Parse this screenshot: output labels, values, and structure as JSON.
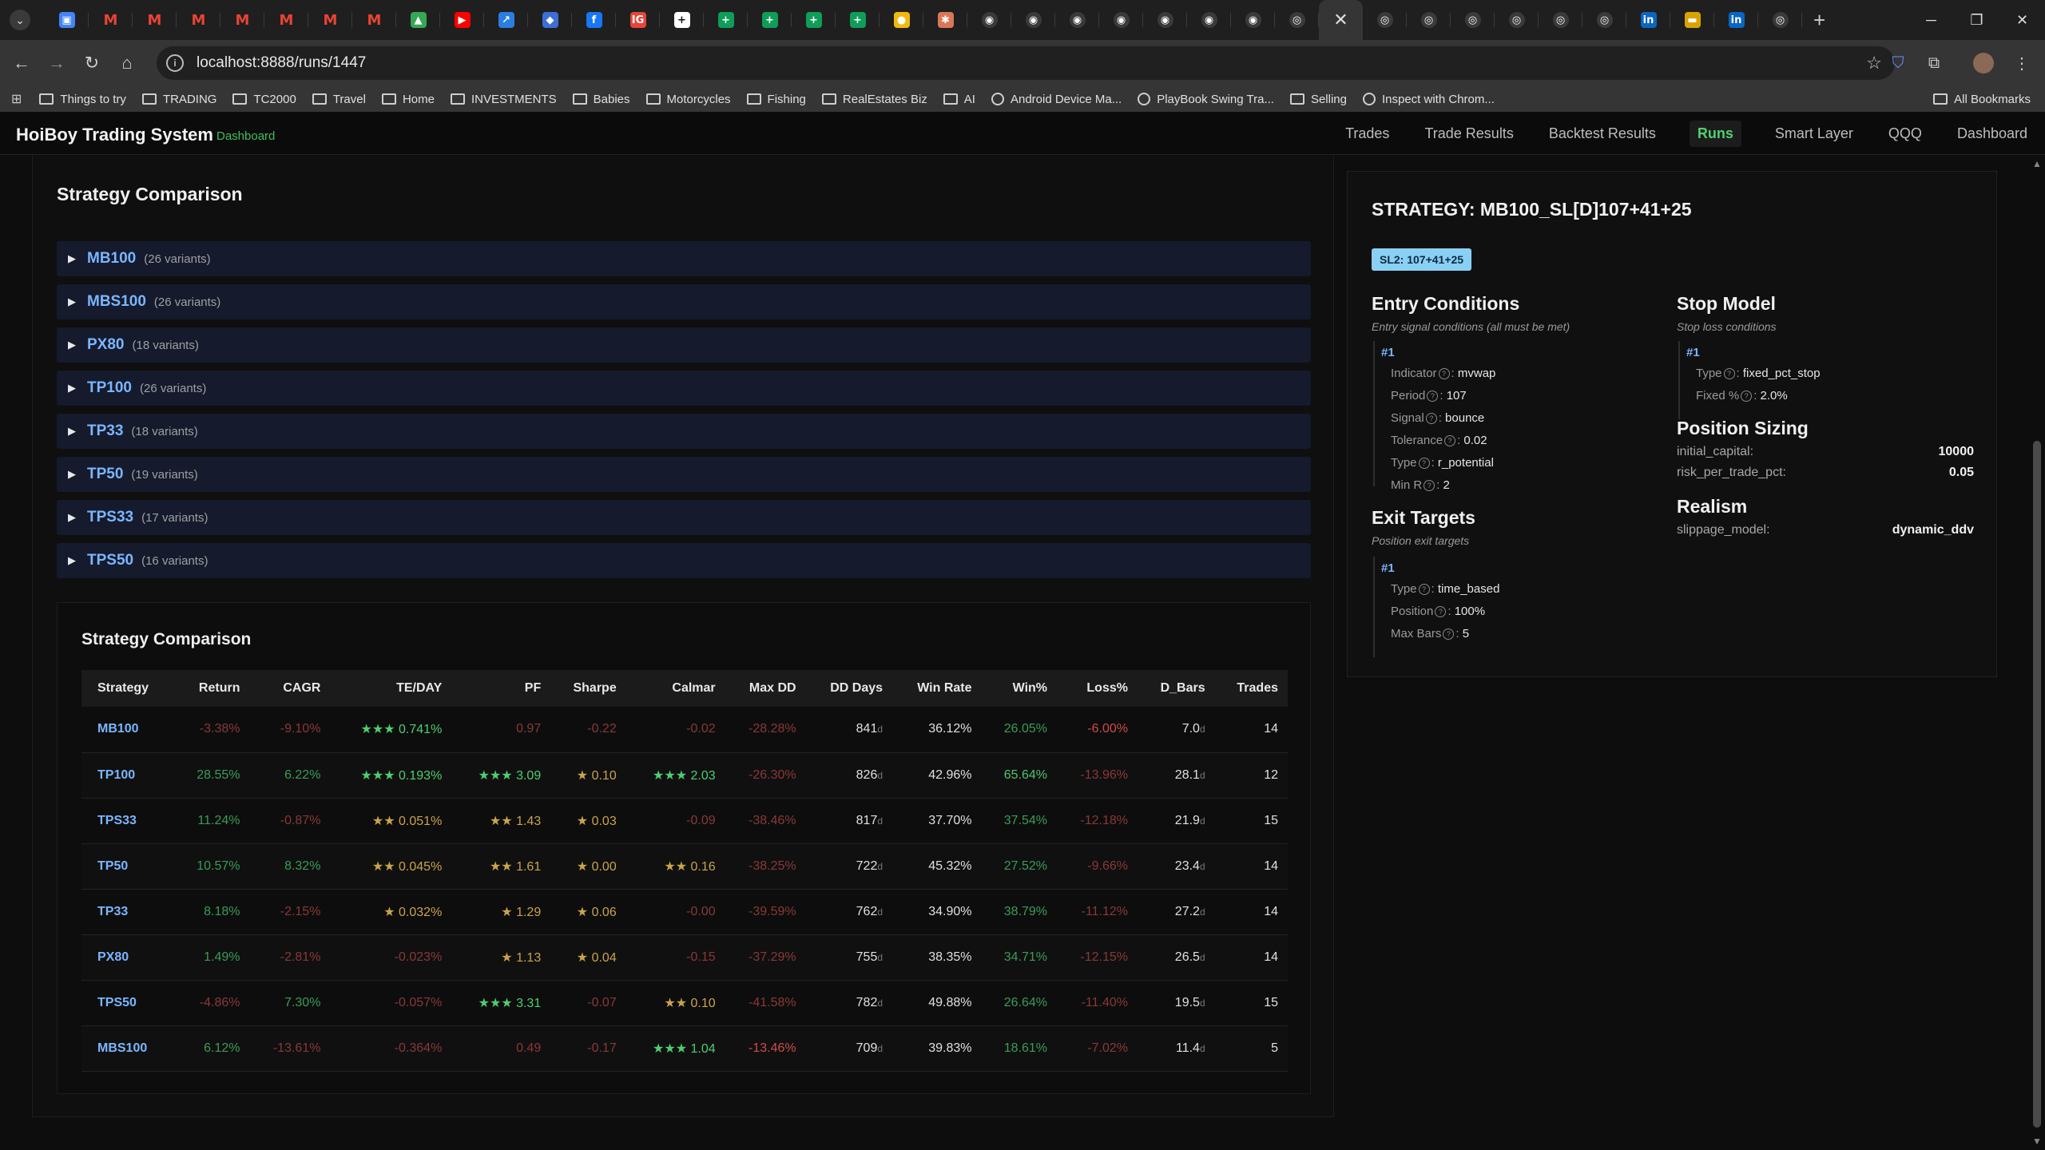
{
  "browser": {
    "url": "localhost:8888/runs/1447",
    "pinned_tabs": [
      {
        "icon": "calendar-icon",
        "color": "#4285f4",
        "glyph": "▣"
      },
      {
        "icon": "gmail-icon",
        "color": "#ea4335",
        "glyph": "M"
      },
      {
        "icon": "gmail-icon",
        "color": "#ea4335",
        "glyph": "M"
      },
      {
        "icon": "gmail-icon",
        "color": "#ea4335",
        "glyph": "M"
      },
      {
        "icon": "gmail-icon",
        "color": "#ea4335",
        "glyph": "M"
      },
      {
        "icon": "gmail-icon",
        "color": "#ea4335",
        "glyph": "M"
      },
      {
        "icon": "gmail-icon",
        "color": "#ea4335",
        "glyph": "M"
      },
      {
        "icon": "gmail-icon",
        "color": "#ea4335",
        "glyph": "M"
      },
      {
        "icon": "drive-icon",
        "color": "#34a853",
        "glyph": "▲"
      },
      {
        "icon": "youtube-music-icon",
        "color": "#ff0000",
        "glyph": "▶"
      },
      {
        "icon": "chart-app-icon",
        "color": "#2a7de1",
        "glyph": "↗"
      },
      {
        "icon": "shield-app-icon",
        "color": "#3b6fd6",
        "glyph": "◆"
      },
      {
        "icon": "facebook-icon",
        "color": "#1877f2",
        "glyph": "f"
      },
      {
        "icon": "ig-icon",
        "color": "#e8443a",
        "glyph": "IG"
      },
      {
        "icon": "plus-app-icon",
        "color": "#ffffff",
        "glyph": "+"
      },
      {
        "icon": "sheets-icon",
        "color": "#0f9d58",
        "glyph": "+"
      },
      {
        "icon": "sheets-icon",
        "color": "#0f9d58",
        "glyph": "+"
      },
      {
        "icon": "sheets-icon",
        "color": "#0f9d58",
        "glyph": "+"
      },
      {
        "icon": "sheets-icon",
        "color": "#0f9d58",
        "glyph": "+"
      },
      {
        "icon": "coin-icon",
        "color": "#f0b90b",
        "glyph": "●"
      },
      {
        "icon": "claude-icon",
        "color": "#d97757",
        "glyph": "✱"
      },
      {
        "icon": "github-icon",
        "color": "#3a3a3a",
        "glyph": "◉"
      },
      {
        "icon": "github-icon",
        "color": "#3a3a3a",
        "glyph": "◉"
      },
      {
        "icon": "github-icon",
        "color": "#3a3a3a",
        "glyph": "◉"
      },
      {
        "icon": "github-icon",
        "color": "#3a3a3a",
        "glyph": "◉"
      },
      {
        "icon": "github-icon",
        "color": "#3a3a3a",
        "glyph": "◉"
      },
      {
        "icon": "github-icon",
        "color": "#3a3a3a",
        "glyph": "◉"
      },
      {
        "icon": "github-icon",
        "color": "#3a3a3a",
        "glyph": "◉"
      },
      {
        "icon": "globe-icon",
        "color": "#3a3a3a",
        "glyph": "◎"
      }
    ],
    "after_tabs": [
      {
        "icon": "globe-icon",
        "color": "#3a3a3a",
        "glyph": "◎"
      },
      {
        "icon": "globe-icon",
        "color": "#3a3a3a",
        "glyph": "◎"
      },
      {
        "icon": "globe-icon",
        "color": "#3a3a3a",
        "glyph": "◎"
      },
      {
        "icon": "globe-icon",
        "color": "#3a3a3a",
        "glyph": "◎"
      },
      {
        "icon": "globe-icon",
        "color": "#3a3a3a",
        "glyph": "◎"
      },
      {
        "icon": "globe-icon",
        "color": "#3a3a3a",
        "glyph": "◎"
      },
      {
        "icon": "linkedin-icon",
        "color": "#0a66c2",
        "glyph": "in"
      },
      {
        "icon": "flag-app-icon",
        "color": "#d9a400",
        "glyph": "▬"
      },
      {
        "icon": "linkedin-icon",
        "color": "#0a66c2",
        "glyph": "in"
      },
      {
        "icon": "globe-icon",
        "color": "#3a3a3a",
        "glyph": "◎"
      }
    ],
    "bookmarks": [
      {
        "label": "Things to try",
        "type": "folder"
      },
      {
        "label": "TRADING",
        "type": "folder"
      },
      {
        "label": "TC2000",
        "type": "folder"
      },
      {
        "label": "Travel",
        "type": "folder"
      },
      {
        "label": "Home",
        "type": "folder"
      },
      {
        "label": "INVESTMENTS",
        "type": "folder"
      },
      {
        "label": "Babies",
        "type": "folder"
      },
      {
        "label": "Motorcycles",
        "type": "folder"
      },
      {
        "label": "Fishing",
        "type": "folder"
      },
      {
        "label": "RealEstates Biz",
        "type": "folder"
      },
      {
        "label": "AI",
        "type": "folder"
      },
      {
        "label": "Android Device Ma...",
        "type": "site"
      },
      {
        "label": "PlayBook Swing Tra...",
        "type": "site"
      },
      {
        "label": "Selling",
        "type": "folder"
      },
      {
        "label": "Inspect with Chrom...",
        "type": "site"
      }
    ],
    "all_bookmarks": "All Bookmarks"
  },
  "app": {
    "title": "HoiBoy Trading System",
    "subtitle": "Dashboard",
    "nav": [
      {
        "label": "Trades",
        "active": false
      },
      {
        "label": "Trade Results",
        "active": false
      },
      {
        "label": "Backtest Results",
        "active": false
      },
      {
        "label": "Runs",
        "active": true
      },
      {
        "label": "Smart Layer",
        "active": false
      },
      {
        "label": "QQQ",
        "active": false
      },
      {
        "label": "Dashboard",
        "active": false
      }
    ]
  },
  "comparison": {
    "title": "Strategy Comparison",
    "groups": [
      {
        "name": "MB100",
        "count": "(26 variants)"
      },
      {
        "name": "MBS100",
        "count": "(26 variants)"
      },
      {
        "name": "PX80",
        "count": "(18 variants)"
      },
      {
        "name": "TP100",
        "count": "(26 variants)"
      },
      {
        "name": "TP33",
        "count": "(18 variants)"
      },
      {
        "name": "TP50",
        "count": "(19 variants)"
      },
      {
        "name": "TPS33",
        "count": "(17 variants)"
      },
      {
        "name": "TPS50",
        "count": "(16 variants)"
      }
    ],
    "table_title": "Strategy Comparison",
    "columns": [
      "Strategy",
      "Return",
      "CAGR",
      "TE/DAY",
      "PF",
      "Sharpe",
      "Calmar",
      "Max DD",
      "DD Days",
      "Win Rate",
      "Win%",
      "Loss%",
      "D_Bars",
      "Trades"
    ],
    "rows": [
      {
        "strategy": "MB100",
        "return": "-3.38%",
        "cagr": "-9.10%",
        "teday_stars": "★★★",
        "teday": "0.741%",
        "pf_stars": "",
        "pf": "0.97",
        "sharpe_stars": "",
        "sharpe": "-0.22",
        "calmar_stars": "",
        "calmar": "-0.02",
        "maxdd": "-28.28%",
        "dddays": "841",
        "dddays_unit": "d",
        "winrate": "36.12%",
        "winpct": "26.05%",
        "losspct": "-6.00%",
        "dbars": "7.0",
        "dbars_unit": "d",
        "trades": "14",
        "styles": {
          "return": "negd",
          "cagr": "negd",
          "teday": "grn",
          "pf": "negd",
          "sharpe": "negd",
          "calmar": "negd",
          "maxdd": "negd",
          "winpct": "posd",
          "losspct": "neg"
        }
      },
      {
        "strategy": "TP100",
        "return": "28.55%",
        "cagr": "6.22%",
        "teday_stars": "★★★",
        "teday": "0.193%",
        "pf_stars": "★★★",
        "pf": "3.09",
        "sharpe_stars": "★",
        "sharpe": "0.10",
        "calmar_stars": "★★★",
        "calmar": "2.03",
        "maxdd": "-26.30%",
        "dddays": "826",
        "dddays_unit": "d",
        "winrate": "42.96%",
        "winpct": "65.64%",
        "losspct": "-13.96%",
        "dbars": "28.1",
        "dbars_unit": "d",
        "trades": "12",
        "styles": {
          "return": "posd",
          "cagr": "posd",
          "teday": "grn",
          "pf": "grn",
          "sharpe": "gold",
          "calmar": "grn",
          "maxdd": "negd",
          "winpct": "pos",
          "losspct": "negd"
        }
      },
      {
        "strategy": "TPS33",
        "return": "11.24%",
        "cagr": "-0.87%",
        "teday_stars": "★★",
        "teday": "0.051%",
        "pf_stars": "★★",
        "pf": "1.43",
        "sharpe_stars": "★",
        "sharpe": "0.03",
        "calmar_stars": "",
        "calmar": "-0.09",
        "maxdd": "-38.46%",
        "dddays": "817",
        "dddays_unit": "d",
        "winrate": "37.70%",
        "winpct": "37.54%",
        "losspct": "-12.18%",
        "dbars": "21.9",
        "dbars_unit": "d",
        "trades": "15",
        "styles": {
          "return": "posd",
          "cagr": "negd",
          "teday": "gold",
          "pf": "gold",
          "sharpe": "gold",
          "calmar": "negd",
          "maxdd": "negd",
          "winpct": "posd",
          "losspct": "negd"
        }
      },
      {
        "strategy": "TP50",
        "return": "10.57%",
        "cagr": "8.32%",
        "teday_stars": "★★",
        "teday": "0.045%",
        "pf_stars": "★★",
        "pf": "1.61",
        "sharpe_stars": "★",
        "sharpe": "0.00",
        "calmar_stars": "★★",
        "calmar": "0.16",
        "maxdd": "-38.25%",
        "dddays": "722",
        "dddays_unit": "d",
        "winrate": "45.32%",
        "winpct": "27.52%",
        "losspct": "-9.66%",
        "dbars": "23.4",
        "dbars_unit": "d",
        "trades": "14",
        "styles": {
          "return": "posd",
          "cagr": "posd",
          "teday": "gold",
          "pf": "gold",
          "sharpe": "gold",
          "calmar": "gold",
          "maxdd": "negd",
          "winpct": "posd",
          "losspct": "negd"
        }
      },
      {
        "strategy": "TP33",
        "return": "8.18%",
        "cagr": "-2.15%",
        "teday_stars": "★",
        "teday": "0.032%",
        "pf_stars": "★",
        "pf": "1.29",
        "sharpe_stars": "★",
        "sharpe": "0.06",
        "calmar_stars": "",
        "calmar": "-0.00",
        "maxdd": "-39.59%",
        "dddays": "762",
        "dddays_unit": "d",
        "winrate": "34.90%",
        "winpct": "38.79%",
        "losspct": "-11.12%",
        "dbars": "27.2",
        "dbars_unit": "d",
        "trades": "14",
        "styles": {
          "return": "posd",
          "cagr": "negd",
          "teday": "gold",
          "pf": "gold",
          "sharpe": "gold",
          "calmar": "negd",
          "maxdd": "negd",
          "winpct": "posd",
          "losspct": "negd"
        }
      },
      {
        "strategy": "PX80",
        "return": "1.49%",
        "cagr": "-2.81%",
        "teday_stars": "",
        "teday": "-0.023%",
        "pf_stars": "★",
        "pf": "1.13",
        "sharpe_stars": "★",
        "sharpe": "0.04",
        "calmar_stars": "",
        "calmar": "-0.15",
        "maxdd": "-37.29%",
        "dddays": "755",
        "dddays_unit": "d",
        "winrate": "38.35%",
        "winpct": "34.71%",
        "losspct": "-12.15%",
        "dbars": "26.5",
        "dbars_unit": "d",
        "trades": "14",
        "styles": {
          "return": "posd",
          "cagr": "negd",
          "teday": "negd",
          "pf": "gold",
          "sharpe": "gold",
          "calmar": "negd",
          "maxdd": "negd",
          "winpct": "posd",
          "losspct": "negd"
        }
      },
      {
        "strategy": "TPS50",
        "return": "-4.86%",
        "cagr": "7.30%",
        "teday_stars": "",
        "teday": "-0.057%",
        "pf_stars": "★★★",
        "pf": "3.31",
        "sharpe_stars": "",
        "sharpe": "-0.07",
        "calmar_stars": "★★",
        "calmar": "0.10",
        "maxdd": "-41.58%",
        "dddays": "782",
        "dddays_unit": "d",
        "winrate": "49.88%",
        "winpct": "26.64%",
        "losspct": "-11.40%",
        "dbars": "19.5",
        "dbars_unit": "d",
        "trades": "15",
        "styles": {
          "return": "negd",
          "cagr": "posd",
          "teday": "negd",
          "pf": "grn",
          "sharpe": "negd",
          "calmar": "gold",
          "maxdd": "negd",
          "winpct": "posd",
          "losspct": "negd"
        }
      },
      {
        "strategy": "MBS100",
        "return": "6.12%",
        "cagr": "-13.61%",
        "teday_stars": "",
        "teday": "-0.364%",
        "pf_stars": "",
        "pf": "0.49",
        "sharpe_stars": "",
        "sharpe": "-0.17",
        "calmar_stars": "★★★",
        "calmar": "1.04",
        "maxdd": "-13.46%",
        "dddays": "709",
        "dddays_unit": "d",
        "winrate": "39.83%",
        "winpct": "18.61%",
        "losspct": "-7.02%",
        "dbars": "11.4",
        "dbars_unit": "d",
        "trades": "5",
        "styles": {
          "return": "posd",
          "cagr": "negd",
          "teday": "negd",
          "pf": "negd",
          "sharpe": "negd",
          "calmar": "grn",
          "maxdd": "neg",
          "winpct": "posd",
          "losspct": "negd"
        }
      }
    ]
  },
  "strategy": {
    "title": "STRATEGY: MB100_SL[D]107+41+25",
    "badge": "SL2: 107+41+25",
    "entry": {
      "heading": "Entry Conditions",
      "sub": "Entry signal conditions (all must be met)",
      "num": "#1",
      "items": [
        {
          "k": "Indicator",
          "v": "mvwap"
        },
        {
          "k": "Period",
          "v": "107"
        },
        {
          "k": "Signal",
          "v": "bounce"
        },
        {
          "k": "Tolerance",
          "v": "0.02"
        },
        {
          "k": "Type",
          "v": "r_potential"
        },
        {
          "k": "Min R",
          "v": "2"
        }
      ]
    },
    "exit": {
      "heading": "Exit Targets",
      "sub": "Position exit targets",
      "num": "#1",
      "items": [
        {
          "k": "Type",
          "v": "time_based"
        },
        {
          "k": "Position",
          "v": "100%"
        },
        {
          "k": "Max Bars",
          "v": "5"
        }
      ]
    },
    "stop": {
      "heading": "Stop Model",
      "sub": "Stop loss conditions",
      "num": "#1",
      "items": [
        {
          "k": "Type",
          "v": "fixed_pct_stop"
        },
        {
          "k": "Fixed %",
          "v": "2.0%"
        }
      ]
    },
    "sizing": {
      "heading": "Position Sizing",
      "items": [
        {
          "k": "initial_capital:",
          "v": "10000"
        },
        {
          "k": "risk_per_trade_pct:",
          "v": "0.05"
        }
      ]
    },
    "realism": {
      "heading": "Realism",
      "items": [
        {
          "k": "slippage_model:",
          "v": "dynamic_ddv"
        }
      ]
    }
  }
}
